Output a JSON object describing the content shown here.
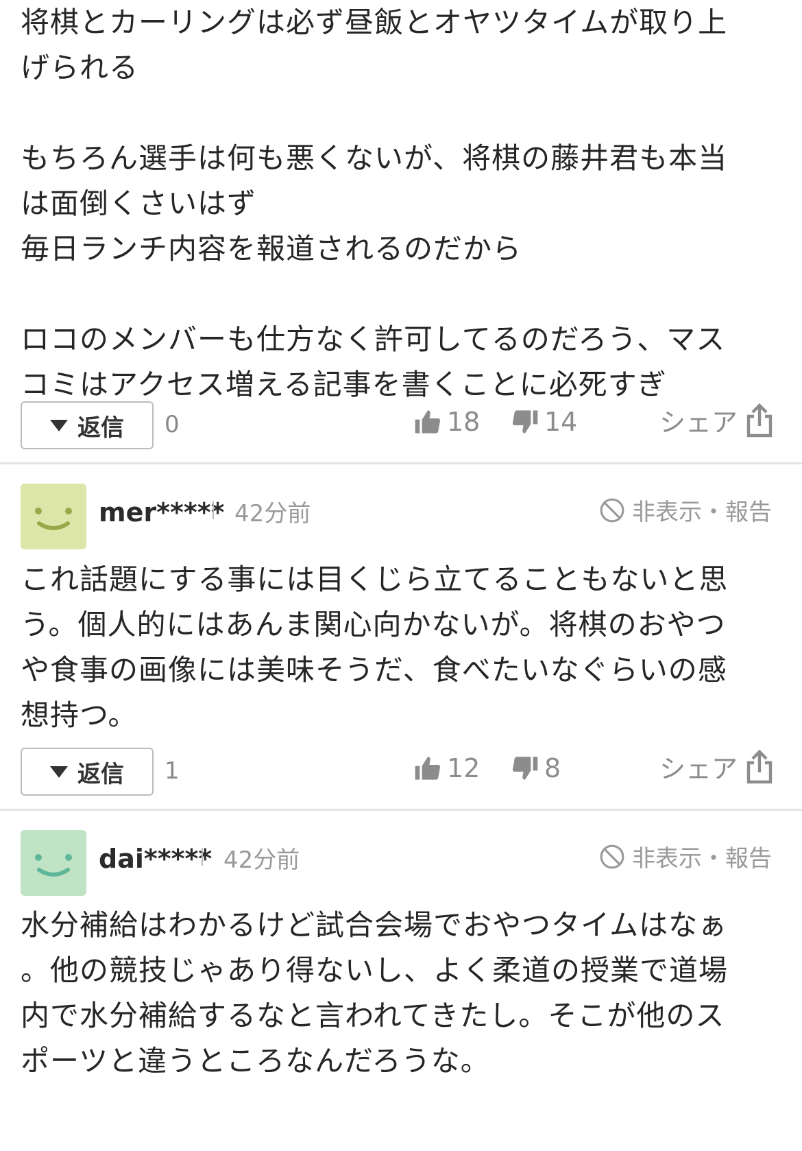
{
  "comment1": {
    "text": "将棋とカーリングは必ず昼飯とオヤツタイムが取り上\nげられる\n\nもちろん選手は何も悪くないが、将棋の藤井君も本当\nは面倒くさいはず\n毎日ランチ内容を報道されるのだから\n\nロコのメンバーも仕方なく許可してるのだろう、マス\nコミはアクセス増える記事を書くことに必死すぎ",
    "reply_label": "返信",
    "reply_count": "0",
    "likes": "18",
    "dislikes": "14",
    "share_label": "シェア"
  },
  "comment2": {
    "username": "mer*****",
    "time": "42分前",
    "hide_report": "非表示・報告",
    "avatar_color": "#dce6a8",
    "text": "これ話題にする事には目くじら立てることもないと思\nう。個人的にはあんま関心向かないが。将棋のおやつ\nや食事の画像には美味そうだ、食べたいなぐらいの感\n想持つ。",
    "reply_label": "返信",
    "reply_count": "1",
    "likes": "12",
    "dislikes": "8",
    "share_label": "シェア"
  },
  "comment3": {
    "username": "dai*****",
    "time": "42分前",
    "hide_report": "非表示・報告",
    "avatar_color": "#bfe3c4",
    "text": "水分補給はわかるけど試合会場でおやつタイムはなぁ\n。他の競技じゃあり得ないし、よく柔道の授業で道場\n内で水分補給するなと言われてきたし。そこが他のス\nポーツと違うところなんだろうな。"
  }
}
